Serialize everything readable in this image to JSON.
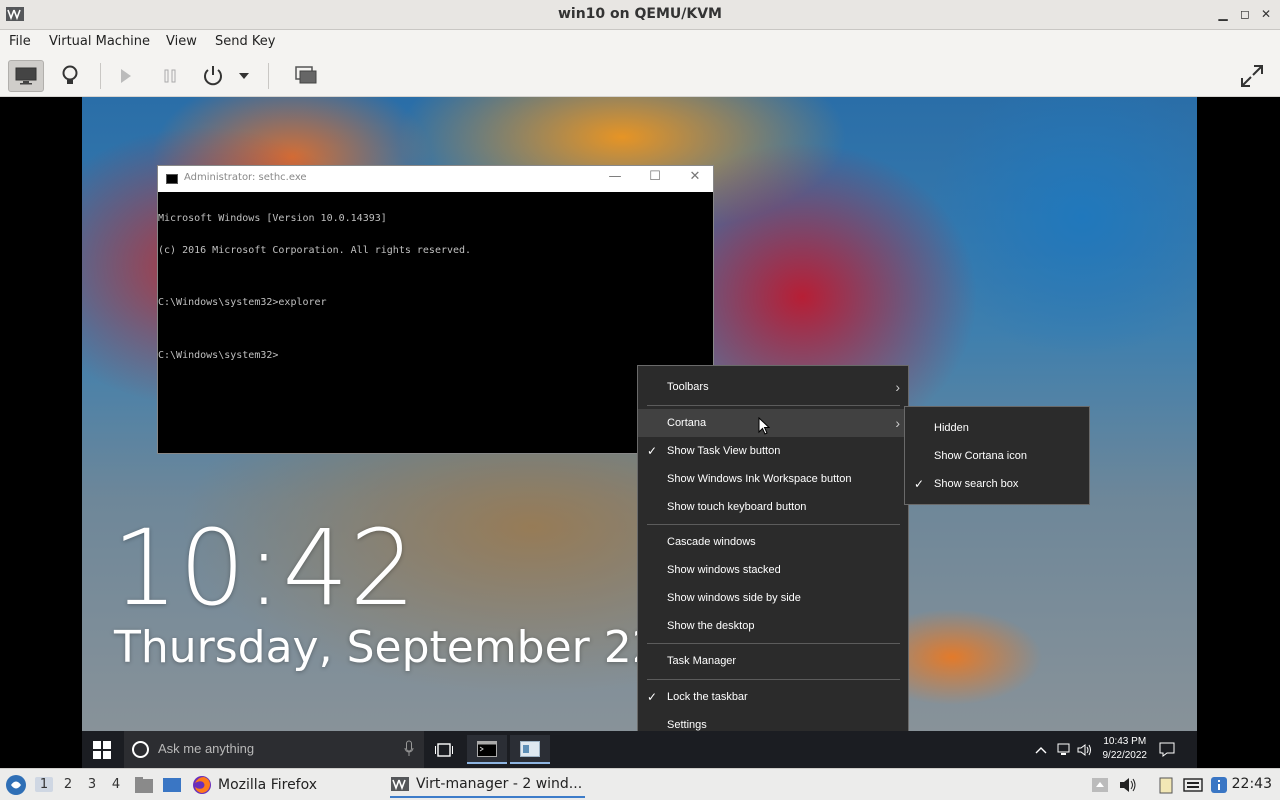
{
  "window": {
    "title": "win10 on QEMU/KVM",
    "minimize": "▁",
    "maximize": "◻",
    "close": "✕"
  },
  "menubar": {
    "items": [
      "File",
      "Virtual Machine",
      "View",
      "Send Key"
    ]
  },
  "toolbar": {
    "icons": [
      "monitor-icon",
      "lightbulb-icon",
      "play-icon",
      "pause-icon",
      "power-icon",
      "dropdown-arrow-icon",
      "snapshots-icon",
      "fullscreen-icon"
    ]
  },
  "cmd": {
    "title": "Administrator: sethc.exe",
    "lines": [
      "Microsoft Windows [Version 10.0.14393]",
      "(c) 2016 Microsoft Corporation. All rights reserved.",
      "",
      "C:\\Windows\\system32>explorer",
      "",
      "C:\\Windows\\system32>"
    ]
  },
  "lock": {
    "time": "10:42",
    "date": "Thursday, September 22"
  },
  "context_menu": {
    "toolbars": "Toolbars",
    "cortana": "Cortana",
    "show_task_view": "Show Task View button",
    "show_ink": "Show Windows Ink Workspace button",
    "show_touch_kb": "Show touch keyboard button",
    "cascade": "Cascade windows",
    "stacked": "Show windows stacked",
    "side_by_side": "Show windows side by side",
    "show_desktop": "Show the desktop",
    "task_manager": "Task Manager",
    "lock_taskbar": "Lock the taskbar",
    "settings": "Settings",
    "check": "✓",
    "arrow": "›"
  },
  "cortana_submenu": {
    "hidden": "Hidden",
    "show_icon": "Show Cortana icon",
    "show_search": "Show search box"
  },
  "guest_taskbar": {
    "search_placeholder": "Ask me anything",
    "time": "10:43 PM",
    "date": "9/22/2022"
  },
  "host_panel": {
    "desktops": [
      "1",
      "2",
      "3",
      "4"
    ],
    "firefox": "Mozilla Firefox",
    "virt_manager": "Virt-manager - 2 wind...",
    "clock": "22:43"
  },
  "colors": {
    "menu_bg": "#2b2b2b",
    "menu_highlight": "#414141",
    "guest_taskbar": "#1b1d22",
    "panel_accent": "#3d7cc9"
  }
}
